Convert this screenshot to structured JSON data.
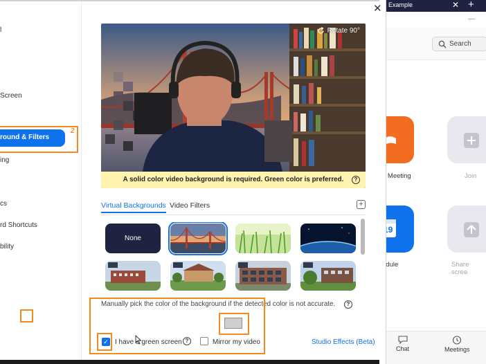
{
  "background_window": {
    "tab_title": "Example",
    "tab_close_icon": "✕",
    "tab_add_icon": "+",
    "minimize_icon": "—",
    "search_placeholder": "Search",
    "tiles": {
      "new_meeting": "o Meeting",
      "join": "Join",
      "schedule": "edule",
      "share_screen": "Share scree"
    },
    "schedule_date": "19",
    "bottom_nav": {
      "chat": "Chat",
      "meetings": "Meetings"
    }
  },
  "sidebar": {
    "items": [
      {
        "label": "l"
      },
      {
        "label": "Screen"
      },
      {
        "label": "round & Filters"
      },
      {
        "label": "ing"
      },
      {
        "label": "cs"
      },
      {
        "label": "rd Shortcuts"
      },
      {
        "label": "bility"
      }
    ],
    "active_index": 2,
    "annotation_number": "2"
  },
  "dialog": {
    "close_icon": "✕",
    "preview": {
      "rotate_label": "Rotate 90°",
      "warning": "A solid color video background is required. Green color is preferred.",
      "help_icon": "?"
    },
    "tabs": {
      "virtual_backgrounds": "Virtual Backgrounds",
      "video_filters": "Video Filters",
      "add_icon": "+"
    },
    "backgrounds": [
      {
        "label": "None",
        "kind": "none"
      },
      {
        "label": "",
        "kind": "golden-gate",
        "selected": true
      },
      {
        "label": "",
        "kind": "grass"
      },
      {
        "label": "",
        "kind": "earth"
      },
      {
        "label": "",
        "kind": "building-1"
      },
      {
        "label": "",
        "kind": "building-2"
      },
      {
        "label": "",
        "kind": "building-3"
      },
      {
        "label": "",
        "kind": "building-4"
      }
    ],
    "manual_pick_text": "Manually pick the color of the background if the detected color is not accurate.",
    "green_screen_label": "I have a green screen",
    "green_screen_checked": true,
    "mirror_label": "Mirror my video",
    "mirror_checked": false,
    "studio_effects_label": "Studio Effects (Beta)"
  },
  "colors": {
    "accent": "#0e72ed",
    "highlight": "#f28a1c",
    "warning_bg": "#fff3b0"
  }
}
